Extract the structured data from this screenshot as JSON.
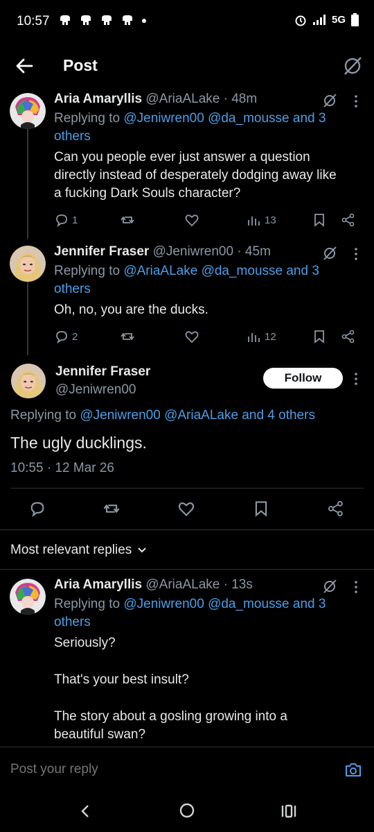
{
  "status_bar": {
    "time": "10:57",
    "network": "5G"
  },
  "header": {
    "title": "Post"
  },
  "replies_above": [
    {
      "name": "Aria Amaryllis",
      "handle": "@AriaALake",
      "time": "· 48m",
      "replying_prefix": "Replying to ",
      "replying_links": "@Jeniwren00 @da_mousse and 3",
      "replying_links2": "others",
      "text_lines": [
        "Can you people ever just answer a question",
        "directly instead of desperately dodging away like",
        "a fucking Dark Souls character?"
      ],
      "replies": "1",
      "reposts": "",
      "likes": "",
      "views": "13"
    },
    {
      "name": "Jennifer Fraser",
      "handle": "@Jeniwren00",
      "time": "· 45m",
      "replying_prefix": "Replying to ",
      "replying_links": "@AriaALake @da_mousse and 3",
      "replying_links2": "others",
      "text_lines": [
        "Oh, no, you are the ducks."
      ],
      "replies": "2",
      "reposts": "",
      "likes": "",
      "views": "12"
    }
  ],
  "main_post": {
    "name": "Jennifer Fraser",
    "handle": "@Jeniwren00",
    "follow_label": "Follow",
    "replying_prefix": "Replying to ",
    "replying_links": "@Jeniwren00 @AriaALake and 4 others",
    "text": "The ugly ducklings.",
    "timestamp": "10:55 · 12 Mar 26"
  },
  "sort": {
    "label": "Most relevant replies"
  },
  "reply_below": {
    "name": "Aria Amaryllis",
    "handle": "@AriaALake",
    "time": "· 13s",
    "replying_prefix": "Replying to ",
    "replying_links": "@Jeniwren00 @da_mousse and 3",
    "replying_links2": "others",
    "para1": "Seriously?",
    "para2": "That's your best insult?",
    "para3_line1": "The story about a gosling growing into a",
    "para3_line2": "beautiful swan?"
  },
  "composer": {
    "placeholder": "Post your reply"
  },
  "colors": {
    "accent": "#4c9ee6",
    "muted": "#8b98a5",
    "background": "#000000"
  }
}
